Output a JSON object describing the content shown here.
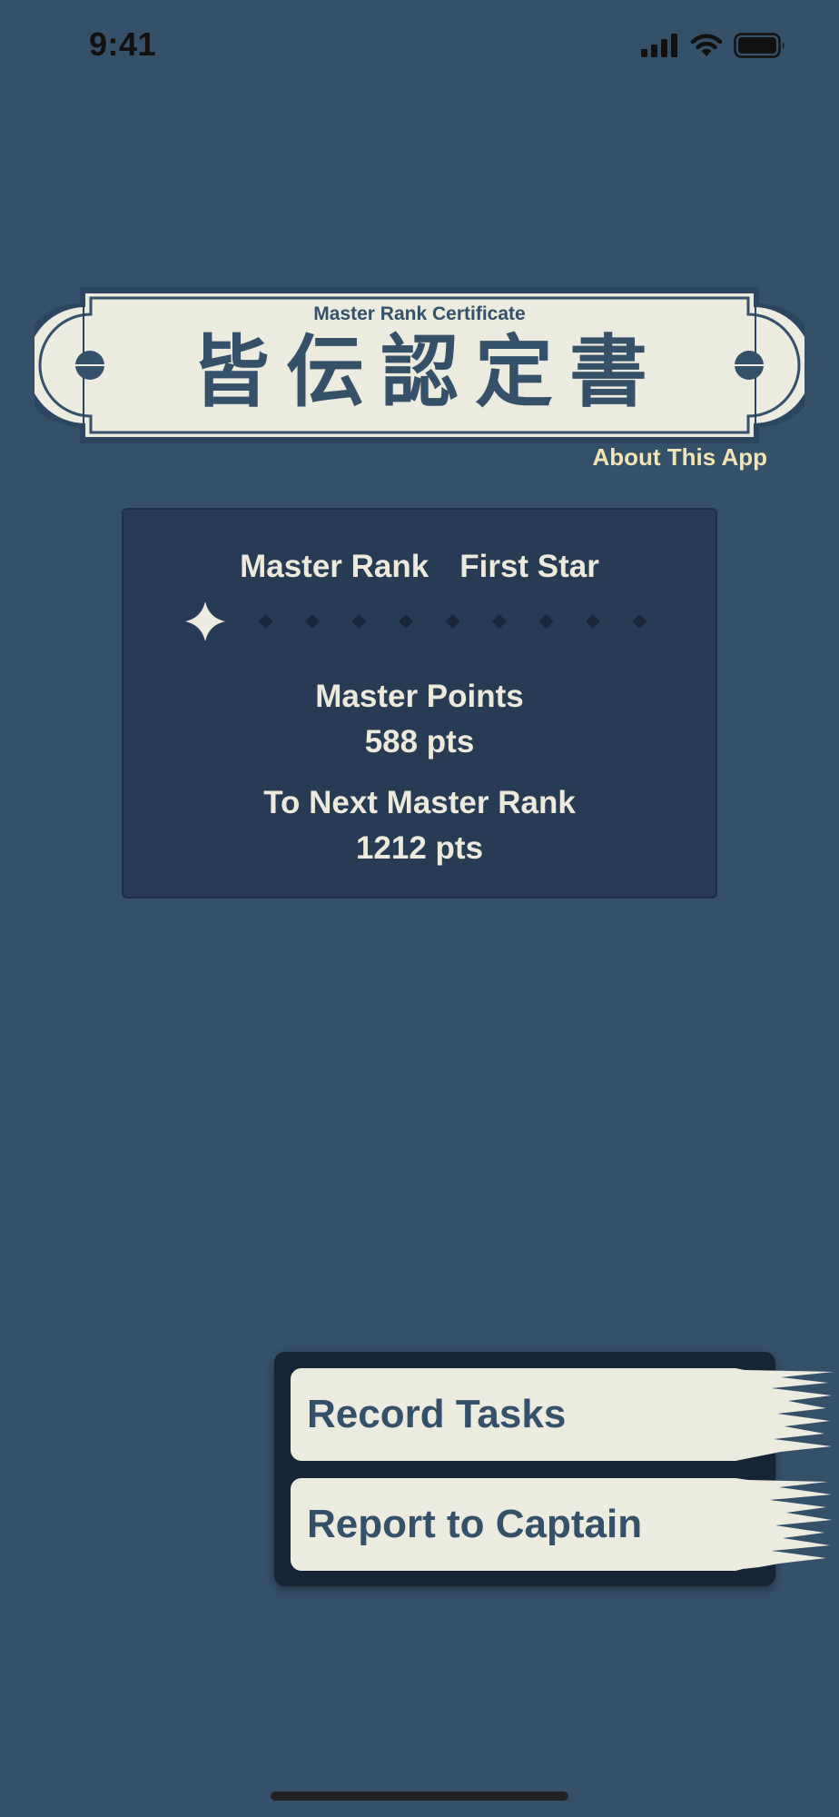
{
  "status_bar": {
    "time": "9:41",
    "icons": [
      "cellular-signal-icon",
      "wifi-icon",
      "battery-icon"
    ]
  },
  "header": {
    "subtitle": "Master Rank Certificate",
    "title": "皆伝認定書",
    "about_link": "About This App"
  },
  "rank_card": {
    "rank_label": "Master Rank",
    "rank_value": "First Star",
    "stars_earned": 1,
    "stars_total": 10,
    "points_label": "Master Points",
    "points_value": "588 pts",
    "next_label": "To Next Master Rank",
    "next_value": "1212 pts"
  },
  "actions": {
    "record_tasks": "Record Tasks",
    "report_to_captain": "Report to Captain"
  },
  "colors": {
    "background": "#355069",
    "card": "#283b54",
    "cream": "#ecebe0",
    "accent_text": "#efe6b3",
    "panel": "#162536"
  }
}
